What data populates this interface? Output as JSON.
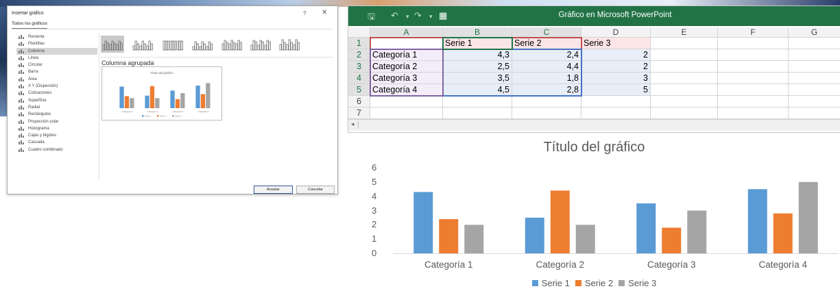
{
  "dialog": {
    "title": "Insertar gráfico",
    "help_label": "?",
    "close_label": "✕",
    "tab_label": "Todos los gráficos",
    "items": [
      {
        "label": "Reciente",
        "icon": "recent-icon"
      },
      {
        "label": "Plantillas",
        "icon": "folder-icon"
      },
      {
        "label": "Columna",
        "icon": "column-chart-icon",
        "selected": true
      },
      {
        "label": "Línea",
        "icon": "line-chart-icon"
      },
      {
        "label": "Circular",
        "icon": "pie-chart-icon"
      },
      {
        "label": "Barra",
        "icon": "bar-chart-icon"
      },
      {
        "label": "Área",
        "icon": "area-chart-icon"
      },
      {
        "label": "X Y (Dispersión)",
        "icon": "scatter-chart-icon"
      },
      {
        "label": "Cotizaciones",
        "icon": "stock-chart-icon"
      },
      {
        "label": "Superficie",
        "icon": "surface-chart-icon"
      },
      {
        "label": "Radial",
        "icon": "radar-chart-icon"
      },
      {
        "label": "Rectángulos",
        "icon": "treemap-chart-icon"
      },
      {
        "label": "Proyección solar",
        "icon": "sunburst-chart-icon"
      },
      {
        "label": "Histograma",
        "icon": "histogram-chart-icon"
      },
      {
        "label": "Cajas y bigotes",
        "icon": "box-whisker-chart-icon"
      },
      {
        "label": "Cascada",
        "icon": "waterfall-chart-icon"
      },
      {
        "label": "Cuadro combinado",
        "icon": "combo-chart-icon"
      }
    ],
    "subtype_heading": "Columna agrupada",
    "preview_title": "Título del gráfico",
    "ok_label": "Aceptar",
    "cancel_label": "Cancelar"
  },
  "excel": {
    "title": "Gráfico en Microsoft PowerPoint",
    "columns": [
      "A",
      "B",
      "C",
      "D",
      "E",
      "F",
      "G"
    ],
    "rows": [
      "1",
      "2",
      "3",
      "4",
      "5",
      "6",
      "7"
    ],
    "cells": [
      [
        "",
        "Serie 1",
        "Serie 2",
        "Serie 3",
        "",
        "",
        ""
      ],
      [
        "Categoría 1",
        "4,3",
        "2,4",
        "2",
        "",
        "",
        ""
      ],
      [
        "Categoría 2",
        "2,5",
        "4,4",
        "2",
        "",
        "",
        ""
      ],
      [
        "Categoría 3",
        "3,5",
        "1,8",
        "3",
        "",
        "",
        ""
      ],
      [
        "Categoría 4",
        "4,5",
        "2,8",
        "5",
        "",
        "",
        ""
      ],
      [
        "",
        "",
        "",
        "",
        "",
        "",
        ""
      ],
      [
        "",
        "",
        "",
        "",
        "",
        "",
        ""
      ]
    ]
  },
  "chart_data": {
    "type": "bar",
    "title": "Título del gráfico",
    "categories": [
      "Categoría 1",
      "Categoría 2",
      "Categoría 3",
      "Categoría 4"
    ],
    "series": [
      {
        "name": "Serie 1",
        "values": [
          4.3,
          2.5,
          3.5,
          4.5
        ],
        "color": "#5b9bd5"
      },
      {
        "name": "Serie 2",
        "values": [
          2.4,
          4.4,
          1.8,
          2.8
        ],
        "color": "#ed7d31"
      },
      {
        "name": "Serie 3",
        "values": [
          2,
          2,
          3,
          5
        ],
        "color": "#a5a5a5"
      }
    ],
    "yticks": [
      "0",
      "1",
      "2",
      "3",
      "4",
      "5",
      "6"
    ],
    "ylim": [
      0,
      6
    ],
    "legend_position": "bottom",
    "grid": false
  }
}
